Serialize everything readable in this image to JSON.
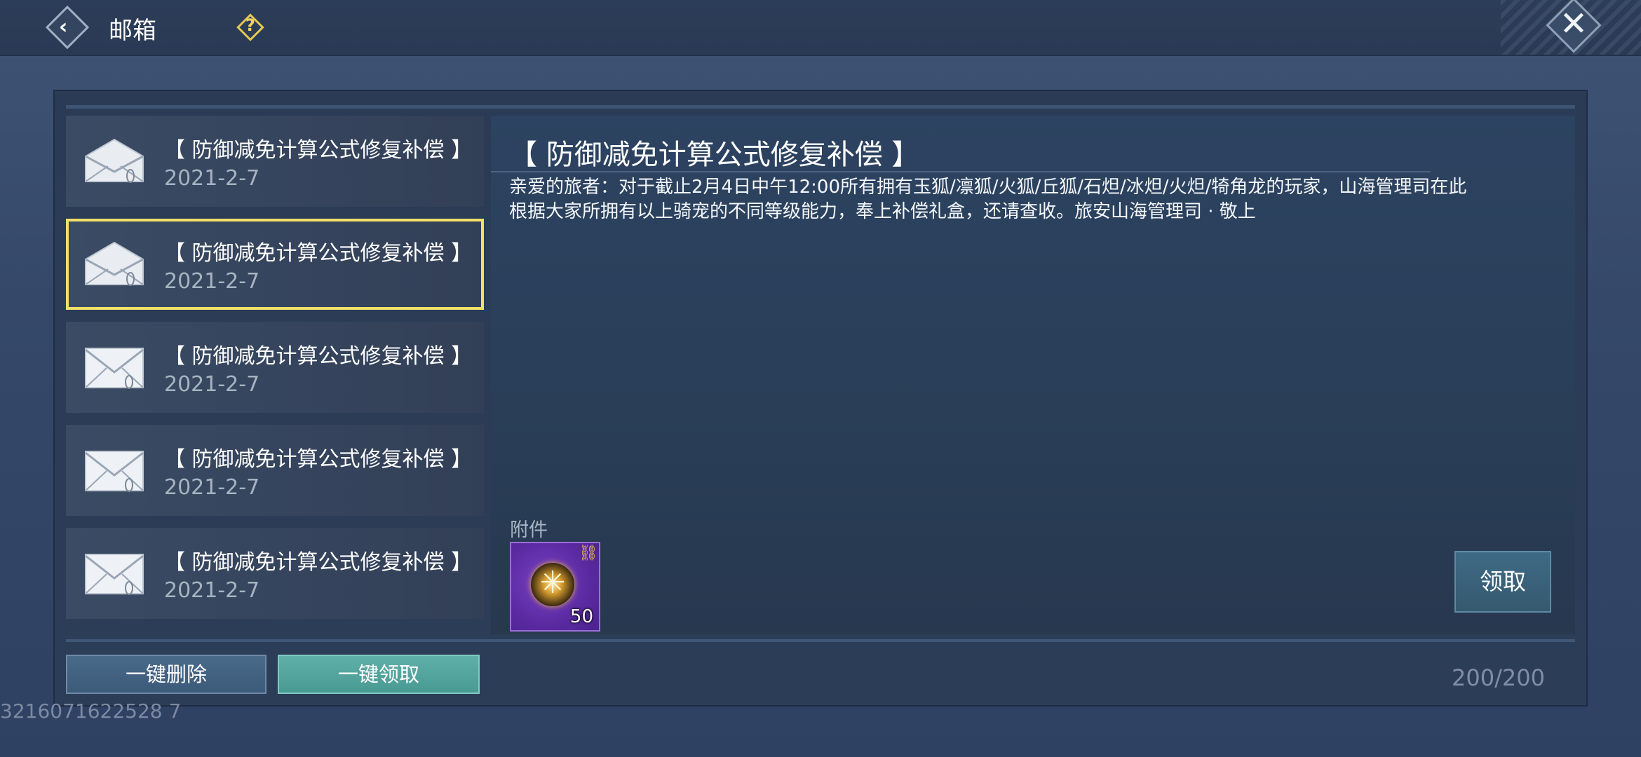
{
  "header": {
    "title": "邮箱",
    "back_icon": "back-arrow-icon",
    "help_icon": "help-question-icon",
    "close_icon": "close-x-icon"
  },
  "mail_list": [
    {
      "subject": "【 防御减免计算公式修复补偿 】",
      "date": "2021-2-7",
      "state": "opened"
    },
    {
      "subject": "【 防御减免计算公式修复补偿 】",
      "date": "2021-2-7",
      "state": "opened",
      "selected": true
    },
    {
      "subject": "【 防御减免计算公式修复补偿 】",
      "date": "2021-2-7",
      "state": "unread"
    },
    {
      "subject": "【 防御减免计算公式修复补偿 】",
      "date": "2021-2-7",
      "state": "unread"
    },
    {
      "subject": "【 防御减免计算公式修复补偿 】",
      "date": "2021-2-7",
      "state": "unread"
    }
  ],
  "detail": {
    "title": "【 防御减免计算公式修复补偿 】",
    "body_line1": "亲爱的旅者：对于截止2月4日中午12:00所有拥有玉狐/凛狐/火狐/丘狐/石炟/冰炟/火炟/犄角龙的玩家，山海管理司在此",
    "body_line2": "根据大家所拥有以上骑宠的不同等级能力，奉上补偿礼盒，还请查收。旅安山海管理司 · 敬上",
    "attachment_label": "附件",
    "attachment": {
      "quantity": "50",
      "icon": "gift-orb-icon"
    },
    "claim_button": "领取"
  },
  "footer": {
    "delete_all": "一键删除",
    "claim_all": "一键领取",
    "mail_count": "200/200",
    "uid": "3216071622528 7"
  },
  "colors": {
    "selected_border": "#f2e069",
    "claim_all_bg": "#5fb0a8",
    "delete_all_bg": "#4a6a8a",
    "attachment_bg": "#6a35b5"
  }
}
